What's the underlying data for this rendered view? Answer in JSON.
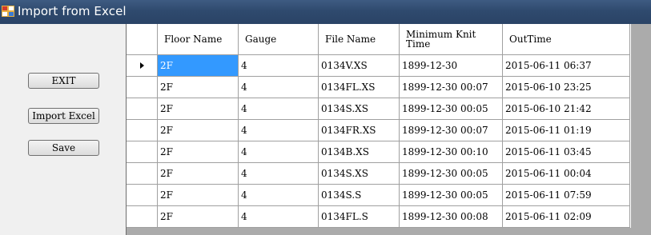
{
  "window": {
    "title": "Import from Excel"
  },
  "buttons": {
    "exit": "EXIT",
    "import_excel": "Import Excel",
    "save": "Save"
  },
  "grid": {
    "columns": [
      "Floor Name",
      "Gauge",
      "File Name",
      "Minimum Knit Time",
      "OutTime"
    ],
    "rows": [
      {
        "floor": "2F",
        "gauge": "4",
        "file": "0134V.XS",
        "knit": "1899-12-30",
        "out": "2015-06-11 06:37"
      },
      {
        "floor": "2F",
        "gauge": "4",
        "file": "0134FL.XS",
        "knit": "1899-12-30 00:07",
        "out": "2015-06-10 23:25"
      },
      {
        "floor": "2F",
        "gauge": "4",
        "file": "0134S.XS",
        "knit": "1899-12-30 00:05",
        "out": "2015-06-10 21:42"
      },
      {
        "floor": "2F",
        "gauge": "4",
        "file": "0134FR.XS",
        "knit": "1899-12-30 00:07",
        "out": "2015-06-11 01:19"
      },
      {
        "floor": "2F",
        "gauge": "4",
        "file": "0134B.XS",
        "knit": "1899-12-30 00:10",
        "out": "2015-06-11 03:45"
      },
      {
        "floor": "2F",
        "gauge": "4",
        "file": "0134S.XS",
        "knit": "1899-12-30 00:05",
        "out": "2015-06-11 00:04"
      },
      {
        "floor": "2F",
        "gauge": "4",
        "file": "0134S.S",
        "knit": "1899-12-30 00:05",
        "out": "2015-06-11 07:59"
      },
      {
        "floor": "2F",
        "gauge": "4",
        "file": "0134FL.S",
        "knit": "1899-12-30 00:08",
        "out": "2015-06-11 02:09"
      }
    ],
    "selected_row": 0
  },
  "colors": {
    "titlebar": "#2f4a6e",
    "selection": "#3399ff",
    "grid_background": "#ababab"
  }
}
